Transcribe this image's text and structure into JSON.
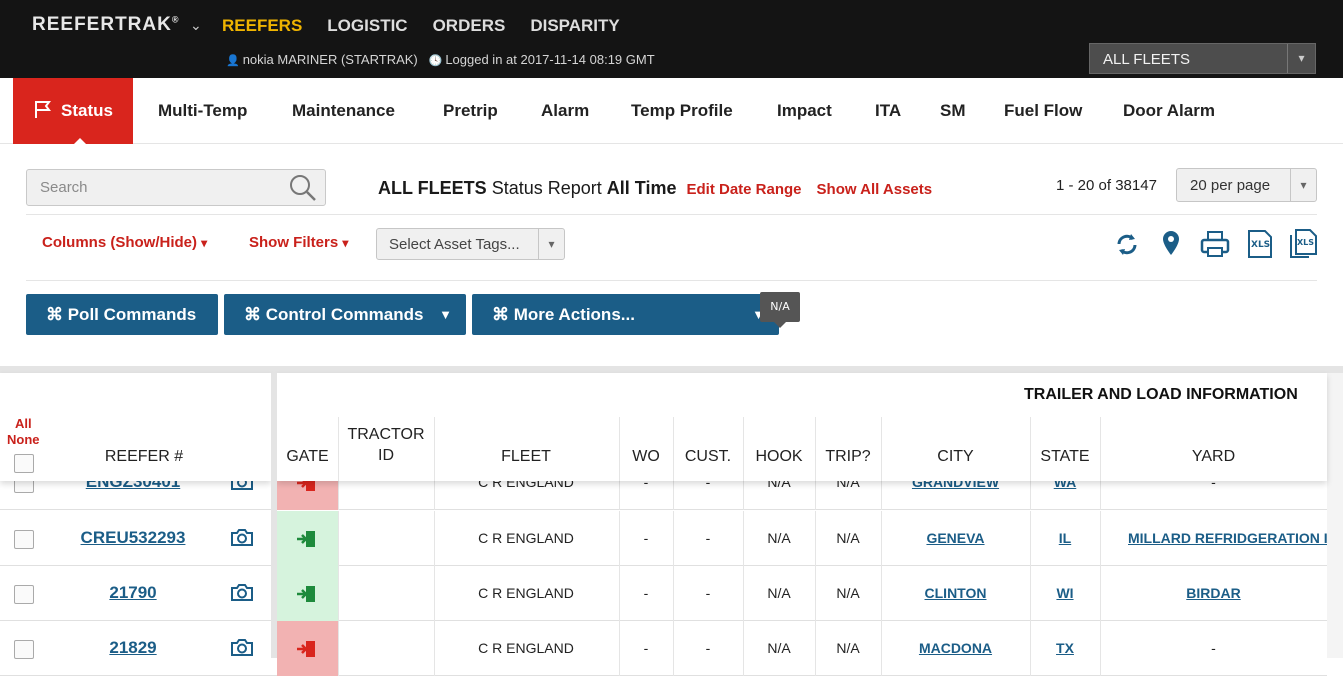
{
  "app": {
    "brand": "REEFERTRAK",
    "brand_mark": "®"
  },
  "topnav": [
    {
      "label": "REEFERS",
      "active": true
    },
    {
      "label": "LOGISTIC"
    },
    {
      "label": "ORDERS"
    },
    {
      "label": "DISPARITY"
    }
  ],
  "user": {
    "name": "nokia MARINER (STARTRAK)",
    "login": "Logged in at 2017-11-14 08:19 GMT"
  },
  "fleet_select": {
    "value": "ALL FLEETS"
  },
  "tabs": [
    "Status",
    "Multi-Temp",
    "Maintenance",
    "Pretrip",
    "Alarm",
    "Temp Profile",
    "Impact",
    "ITA",
    "SM",
    "Fuel Flow",
    "Door Alarm"
  ],
  "search": {
    "placeholder": "Search"
  },
  "report": {
    "fleet": "ALL FLEETS",
    "name": "Status Report",
    "range": "All Time",
    "edit_range": "Edit Date Range",
    "show_all": "Show All Assets"
  },
  "pagination": {
    "count": "1 - 20 of 38147",
    "per_page": "20 per page"
  },
  "filters": {
    "columns": "Columns (Show/Hide)",
    "show_filters": "Show Filters",
    "tags_placeholder": "Select Asset Tags..."
  },
  "commands": {
    "poll": "⌘ Poll Commands",
    "control": "⌘ Control Commands",
    "more": "⌘ More Actions..."
  },
  "tooltip": "N/A",
  "table": {
    "select_all": "All",
    "select_none": "None",
    "group_header": "TRAILER AND LOAD INFORMATION",
    "columns": {
      "reefer": "REEFER #",
      "gate": "GATE",
      "tractor": "TRACTOR ID",
      "fleet": "FLEET",
      "wo": "WO",
      "cust": "CUST.",
      "hook": "HOOK",
      "trip": "TRIP?",
      "city": "CITY",
      "state": "STATE",
      "yard": "YARD"
    },
    "rows": [
      {
        "reefer": "ENGZ30401",
        "gate": "out",
        "tractor": "",
        "fleet": "C R ENGLAND",
        "wo": "-",
        "cust": "-",
        "hook": "N/A",
        "trip": "N/A",
        "city": "GRANDVIEW",
        "state": "WA",
        "yard": "-"
      },
      {
        "reefer": "CREU532293",
        "gate": "in",
        "tractor": "",
        "fleet": "C R ENGLAND",
        "wo": "-",
        "cust": "-",
        "hook": "N/A",
        "trip": "N/A",
        "city": "GENEVA",
        "state": "IL",
        "yard": "MILLARD REFRIDGERATION I"
      },
      {
        "reefer": "21790",
        "gate": "in",
        "tractor": "",
        "fleet": "C R ENGLAND",
        "wo": "-",
        "cust": "-",
        "hook": "N/A",
        "trip": "N/A",
        "city": "CLINTON",
        "state": "WI",
        "yard": "BIRDAR"
      },
      {
        "reefer": "21829",
        "gate": "out",
        "tractor": "",
        "fleet": "C R ENGLAND",
        "wo": "-",
        "cust": "-",
        "hook": "N/A",
        "trip": "N/A",
        "city": "MACDONA",
        "state": "TX",
        "yard": "-"
      }
    ]
  },
  "colors": {
    "accent_red": "#d9251d",
    "link_blue": "#1b5d87",
    "nav_gold": "#f0b400",
    "gate_in": "#d6f3dd",
    "gate_out": "#f2b2b2"
  }
}
